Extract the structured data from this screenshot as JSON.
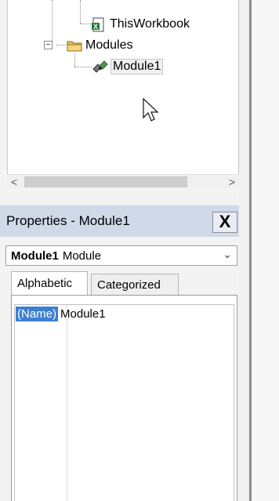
{
  "project_tree": {
    "items": [
      {
        "label": "ThisWorkbook",
        "icon": "excel-workbook-icon"
      },
      {
        "label": "Modules",
        "icon": "folder-icon",
        "expanded": true
      },
      {
        "label": "Module1",
        "icon": "module-icon",
        "selected": true
      }
    ],
    "scroll_left": "<",
    "scroll_right": ">"
  },
  "properties": {
    "title": "Properties - Module1",
    "close_glyph": "X",
    "object_name": "Module1",
    "object_type": "Module",
    "tabs": [
      {
        "label": "Alphabetic",
        "active": true
      },
      {
        "label": "Categorized",
        "active": false
      }
    ],
    "rows": [
      {
        "name": "(Name)",
        "value": "Module1"
      }
    ]
  },
  "colors": {
    "title_bar": "#cfd9e8",
    "selection": "#3c7fd4"
  }
}
